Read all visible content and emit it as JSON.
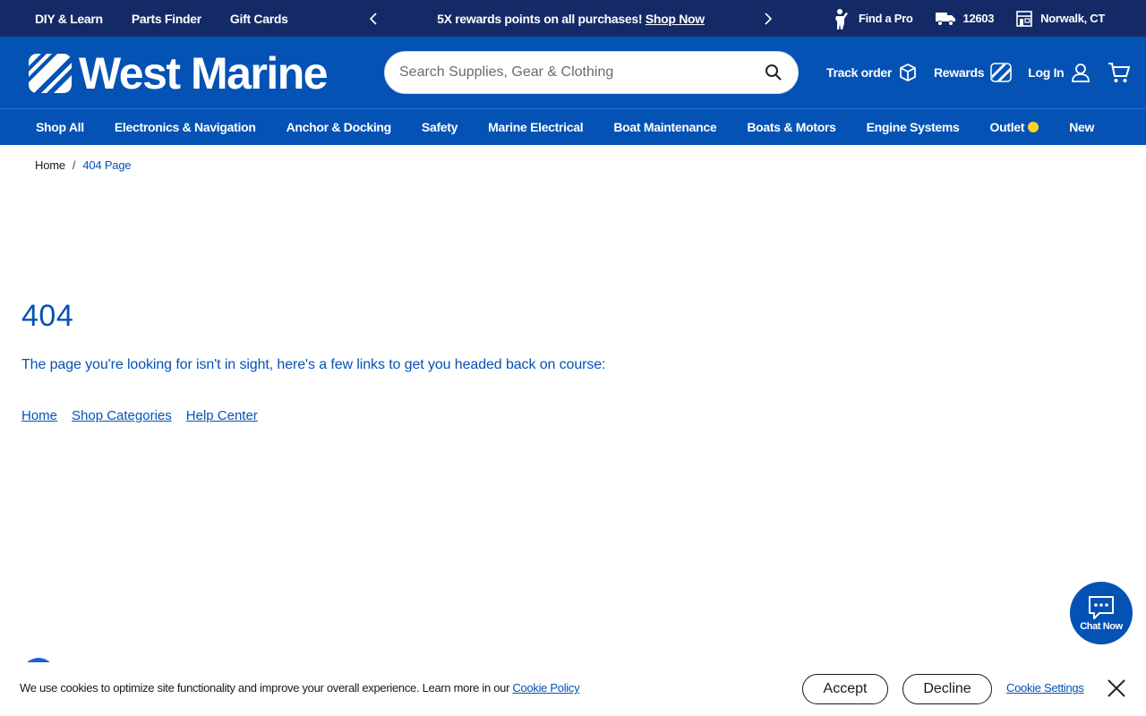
{
  "utility_bar": {
    "links": [
      "DIY & Learn",
      "Parts Finder",
      "Gift Cards"
    ],
    "promo_text": "5X rewards points on all purchases!",
    "promo_link": "Shop Now",
    "find_pro": "Find a Pro",
    "zip": "12603",
    "store": "Norwalk, CT"
  },
  "header": {
    "logo_text": "West Marine",
    "search_placeholder": "Search Supplies, Gear & Clothing",
    "track_order": "Track order",
    "rewards": "Rewards",
    "login": "Log In"
  },
  "categories": [
    "Shop All",
    "Electronics & Navigation",
    "Anchor & Docking",
    "Safety",
    "Marine Electrical",
    "Boat Maintenance",
    "Boats & Motors",
    "Engine Systems",
    "Outlet",
    "New"
  ],
  "breadcrumb": {
    "home": "Home",
    "separator": "/",
    "current": "404 Page"
  },
  "error_page": {
    "code": "404",
    "message": "The page you're looking for isn't in sight, here's a few links to get you headed back on course:",
    "links": [
      "Home",
      "Shop Categories",
      "Help Center"
    ]
  },
  "chat": {
    "label": "Chat Now"
  },
  "cookie_banner": {
    "text": "We use cookies to optimize site functionality and improve your overall experience. Learn more in our",
    "policy_link": "Cookie Policy",
    "accept": "Accept",
    "decline": "Decline",
    "settings": "Cookie Settings"
  },
  "colors": {
    "brand_blue": "#0552b5",
    "navy": "#142a66",
    "outlet_dot": "#ffd21f"
  },
  "icons": [
    "chevron-left-icon",
    "chevron-right-icon",
    "pro-person-icon",
    "truck-icon",
    "store-icon",
    "logo-stripes-icon",
    "search-icon",
    "box-icon",
    "rewards-stripes-icon",
    "user-icon",
    "cart-icon",
    "chat-icon",
    "close-icon"
  ]
}
